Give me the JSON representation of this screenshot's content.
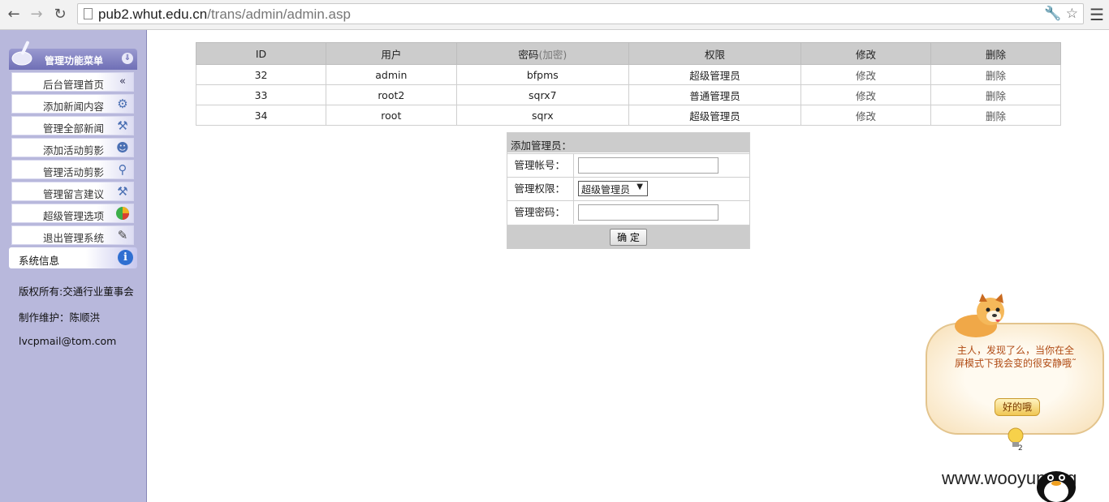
{
  "browser": {
    "url_host": "pub2.whut.edu.cn",
    "url_path": "/trans/admin/admin.asp"
  },
  "sidebar": {
    "menu_title": "管理功能菜单",
    "items": [
      {
        "label": "后台管理首页",
        "icon": "double-chevron-left-icon"
      },
      {
        "label": "添加新闻内容",
        "icon": "gear-pen-icon"
      },
      {
        "label": "管理全部新闻",
        "icon": "hammer-icon"
      },
      {
        "label": "添加活动剪影",
        "icon": "person-icon"
      },
      {
        "label": "管理活动剪影",
        "icon": "magnifier-icon"
      },
      {
        "label": "管理留言建议",
        "icon": "hammer-icon"
      },
      {
        "label": "超级管理选项",
        "icon": "pie-chart-icon"
      },
      {
        "label": "退出管理系统",
        "icon": "stamp-icon"
      }
    ],
    "sysinfo_label": "系统信息",
    "copyright": "版权所有:交通行业董事会",
    "maintainer": "制作维护：陈顺洪",
    "email": "lvcpmail@tom.com"
  },
  "admin_table": {
    "headers": {
      "id": "ID",
      "user": "用户",
      "password": "密码",
      "password_hint": "(加密)",
      "role": "权限",
      "edit": "修改",
      "delete": "删除"
    },
    "rows": [
      {
        "id": "32",
        "user": "admin",
        "password": "bfpms",
        "role": "超级管理员",
        "edit": "修改",
        "delete": "删除"
      },
      {
        "id": "33",
        "user": "root2",
        "password": "sqrx7",
        "role": "普通管理员",
        "edit": "修改",
        "delete": "删除"
      },
      {
        "id": "34",
        "user": "root",
        "password": "sqrx",
        "role": "超级管理员",
        "edit": "修改",
        "delete": "删除"
      }
    ]
  },
  "add_form": {
    "title": "添加管理员：",
    "account_label": "管理帐号：",
    "account_value": "",
    "role_label": "管理权限：",
    "role_selected": "超级管理员",
    "password_label": "管理密码：",
    "password_value": "",
    "submit_label": "确 定"
  },
  "popup": {
    "message_line1": "主人，发现了么，当你在全",
    "message_line2": "屏模式下我会变的很安静哦˜",
    "button_label": "好的哦",
    "badge": "2"
  },
  "watermark": "www.wooyun.org"
}
